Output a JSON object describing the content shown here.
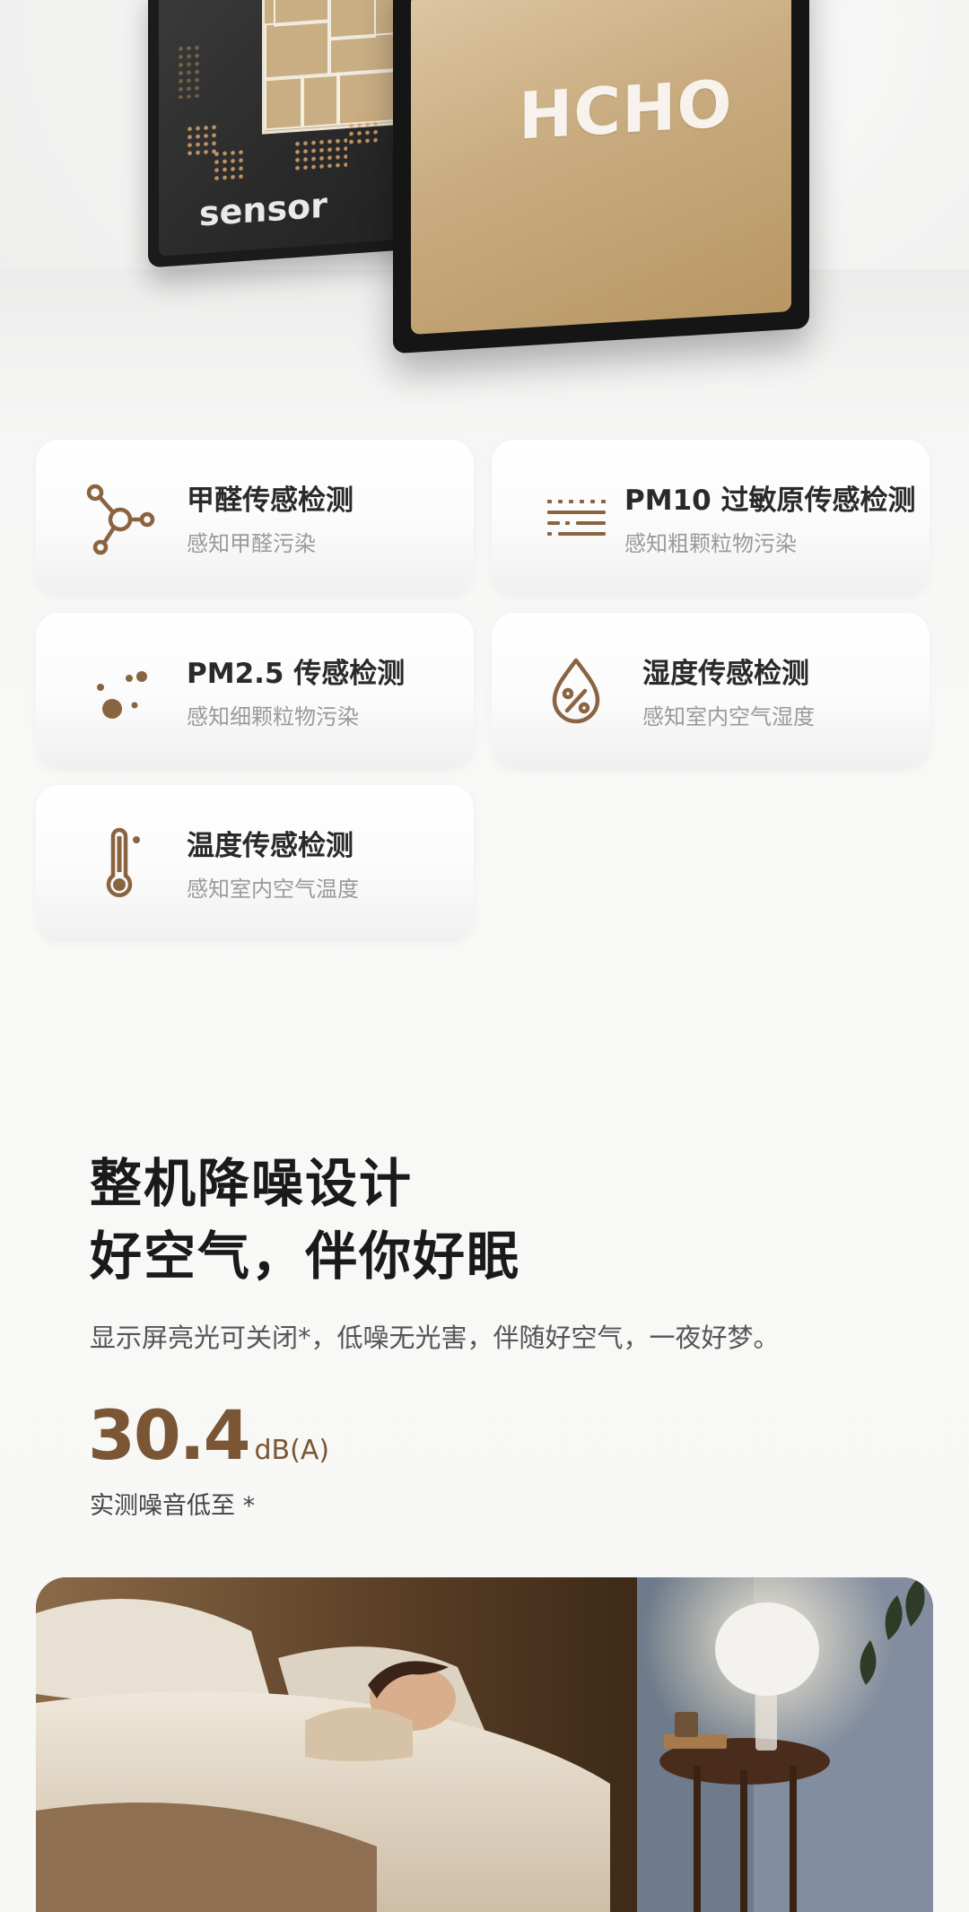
{
  "hero": {
    "back_card_label": "sensor",
    "front_card_label": "HCHO"
  },
  "features": [
    {
      "title": "甲醛传感检测",
      "subtitle": "感知甲醛污染",
      "icon": "molecule-icon"
    },
    {
      "title": "PM10 过敏原传感检测",
      "subtitle": "感知粗颗粒物污染",
      "icon": "dust-lines-icon"
    },
    {
      "title": "PM2.5 传感检测",
      "subtitle": "感知细颗粒物污染",
      "icon": "particles-icon"
    },
    {
      "title": "湿度传感检测",
      "subtitle": "感知室内空气湿度",
      "icon": "humidity-drop-icon"
    },
    {
      "title": "温度传感检测",
      "subtitle": "感知室内空气温度",
      "icon": "thermometer-icon"
    }
  ],
  "noise": {
    "headline_line1": "整机降噪设计",
    "headline_line2": "好空气，伴你好眠",
    "description": "显示屏亮光可关闭*，低噪无光害，伴随好空气，一夜好梦。",
    "value": "30.4",
    "unit": "dB(A)",
    "label": "实测噪音低至 *"
  },
  "colors": {
    "accent_brown": "#7a5634",
    "icon_brown": "#8a6440",
    "title_dark": "#1a1a1a"
  }
}
